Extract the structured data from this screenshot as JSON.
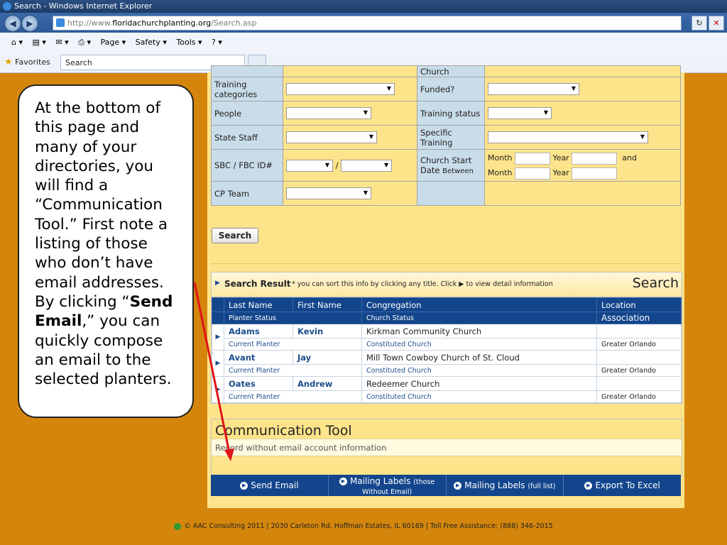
{
  "browser": {
    "window_title": "Search - Windows Internet Explorer",
    "url_prefix": "http://www.",
    "url_domain": "floridachurchplanting.org",
    "url_path": "/Search.asp",
    "commands": [
      "Page ▾",
      "Safety ▾",
      "Tools ▾"
    ],
    "favorites_label": "Favorites",
    "tab_title": "Search"
  },
  "form": {
    "rows": [
      {
        "l1": "Training categories",
        "l2": "Funded?"
      },
      {
        "l1": "People",
        "l2": "Training status"
      },
      {
        "l1": "State Staff",
        "l2": "Specific Training"
      },
      {
        "l1": "SBC / FBC ID#",
        "l2": "Church Start Date",
        "l2_small": "Between",
        "sep": "/",
        "month": "Month",
        "year": "Year",
        "and": "and"
      },
      {
        "l1": "CP Team"
      }
    ],
    "top_label": "Church",
    "search_button": "Search"
  },
  "results": {
    "title": "Search Result",
    "note": "* you can sort this info by clicking any title. Click ▶ to view detail information",
    "big_label": "Search",
    "headers": [
      "Last Name",
      "First Name",
      "Congregation",
      "Location"
    ],
    "subheaders": [
      "Planter Status",
      "Church Status",
      "Association"
    ],
    "rows": [
      {
        "last": "Adams",
        "first": "Kevin",
        "congregation": "Kirkman Community Church",
        "location": "",
        "status": "Current Planter",
        "church_status": "Constituted Church",
        "association": "Greater Orlando"
      },
      {
        "last": "Avant",
        "first": "Jay",
        "congregation": "Mill Town Cowboy Church of St. Cloud",
        "location": "",
        "status": "Current Planter",
        "church_status": "Constituted Church",
        "association": "Greater Orlando"
      },
      {
        "last": "Oates",
        "first": "Andrew",
        "congregation": "Redeemer Church",
        "location": "",
        "status": "Current Planter",
        "church_status": "Constituted Church",
        "association": "Greater Orlando"
      }
    ]
  },
  "communication": {
    "title": "Communication Tool",
    "record_note": "Record without email account information",
    "actions": {
      "send_email": "Send Email",
      "labels_without_main": "Mailing Labels",
      "labels_without_paren": "(those Without Email)",
      "labels_full_main": "Mailing Labels",
      "labels_full_paren": "(full list)",
      "export": "Export To Excel"
    }
  },
  "footer": "© AAC Consulting 2011 | 2030 Carleton Rd. Hoffman Estates, IL 60169 | Toll Free Assistance: (888) 346-2015",
  "callout": {
    "before": "At the bottom of this page and many of your directories, you will find a “Communication Tool.”  First note a listing of those who don’t have email addresses. By clicking “",
    "bold": "Send Email",
    "after": ",” you can quickly compose an email to the selected planters."
  },
  "colors": {
    "accent": "#13458c",
    "page_bg": "#d4860c",
    "panel": "#fde48a",
    "label_bg": "#c9dcea",
    "arrow": "#e0141a"
  }
}
